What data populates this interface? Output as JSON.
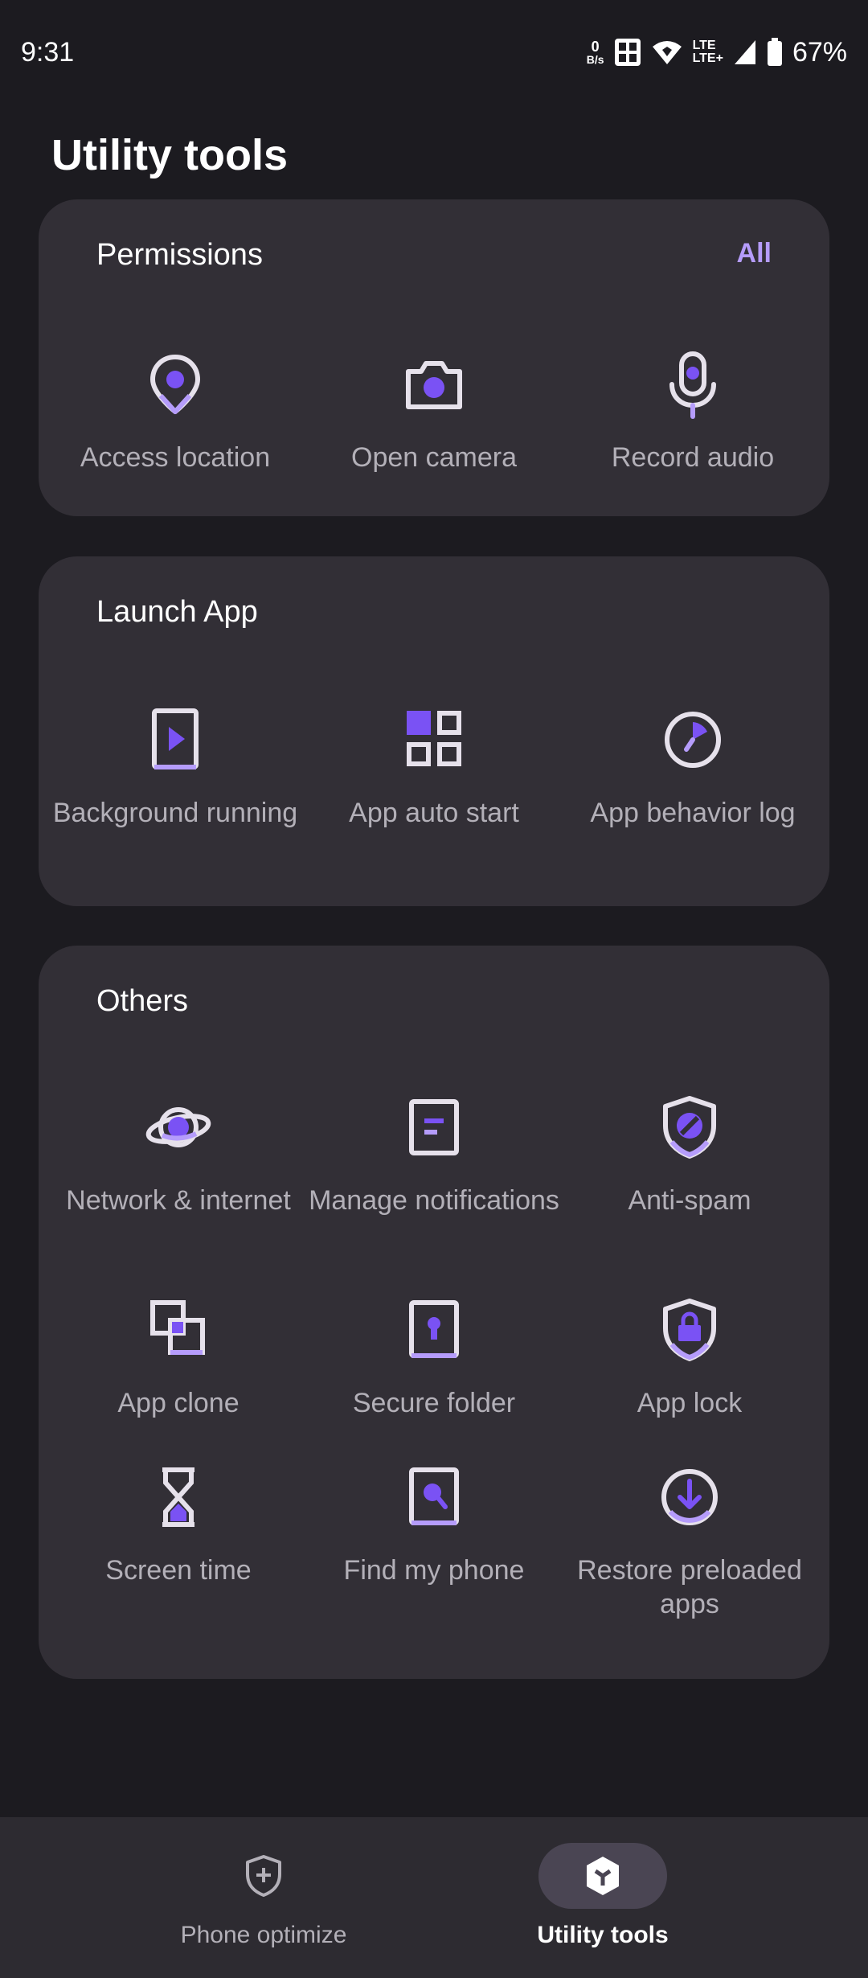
{
  "status": {
    "time": "9:31",
    "net_speed_value": "0",
    "net_speed_unit": "B/s",
    "lte_1": "LTE",
    "lte_2": "LTE+",
    "battery": "67%"
  },
  "page": {
    "title": "Utility tools"
  },
  "permissions": {
    "title": "Permissions",
    "link": "All",
    "items": [
      {
        "label": "Access location",
        "icon": "location-pin-icon"
      },
      {
        "label": "Open camera",
        "icon": "camera-icon"
      },
      {
        "label": "Record audio",
        "icon": "microphone-icon"
      }
    ]
  },
  "launch": {
    "title": "Launch App",
    "items": [
      {
        "label": "Background running",
        "icon": "play-doc-icon"
      },
      {
        "label": "App auto start",
        "icon": "grid-apps-icon"
      },
      {
        "label": "App behavior log",
        "icon": "clock-log-icon"
      }
    ]
  },
  "others": {
    "title": "Others",
    "items": [
      {
        "label": "Network & internet",
        "icon": "planet-icon"
      },
      {
        "label": "Manage notifications",
        "icon": "notification-doc-icon"
      },
      {
        "label": "Anti-spam",
        "icon": "shield-block-icon"
      },
      {
        "label": "App clone",
        "icon": "clone-icon"
      },
      {
        "label": "Secure folder",
        "icon": "keyhole-folder-icon"
      },
      {
        "label": "App lock",
        "icon": "shield-lock-icon"
      },
      {
        "label": "Screen time",
        "icon": "hourglass-icon"
      },
      {
        "label": "Find my phone",
        "icon": "find-phone-icon"
      },
      {
        "label": "Restore preloaded apps",
        "icon": "download-circle-icon"
      }
    ]
  },
  "bottom_nav": {
    "items": [
      {
        "label": "Phone optimize",
        "icon": "shield-plus-icon",
        "active": false
      },
      {
        "label": "Utility tools",
        "icon": "toolbox-icon",
        "active": true
      }
    ]
  },
  "colors": {
    "background": "#1c1b20",
    "card": "#322f36",
    "accent": "#7a52f4",
    "accent_light": "#b59cfb",
    "icon_stroke": "#e6e1eb",
    "label": "#b3b0b8"
  }
}
